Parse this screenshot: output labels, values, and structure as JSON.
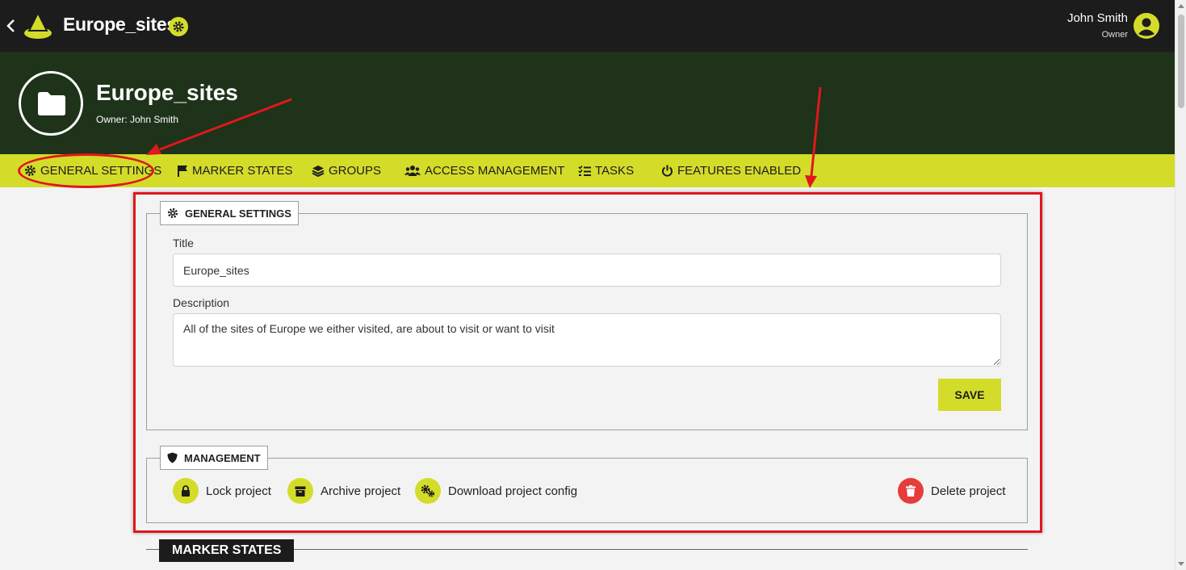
{
  "header": {
    "title": "Europe_sites",
    "user_name": "John Smith",
    "user_role": "Owner"
  },
  "banner": {
    "project_title": "Europe_sites",
    "owner_text": "Owner: John Smith"
  },
  "tabs": [
    {
      "label": "GENERAL SETTINGS",
      "icon": "gear-icon"
    },
    {
      "label": "MARKER STATES",
      "icon": "flag-icon"
    },
    {
      "label": "GROUPS",
      "icon": "layers-icon"
    },
    {
      "label": "ACCESS MANAGEMENT",
      "icon": "users-icon"
    },
    {
      "label": "TASKS",
      "icon": "checklist-icon"
    },
    {
      "label": "FEATURES ENABLED",
      "icon": "power-icon"
    }
  ],
  "general_settings": {
    "legend": "GENERAL SETTINGS",
    "title_label": "Title",
    "title_value": "Europe_sites",
    "description_label": "Description",
    "description_value": "All of the sites of Europe we either visited, are about to visit or want to visit",
    "save_label": "SAVE"
  },
  "management": {
    "legend": "MANAGEMENT",
    "actions": [
      {
        "label": "Lock project",
        "icon": "lock-icon"
      },
      {
        "label": "Archive project",
        "icon": "archive-icon"
      },
      {
        "label": "Download project config",
        "icon": "gears-icon"
      },
      {
        "label": "Delete project",
        "icon": "trash-icon"
      }
    ]
  },
  "marker_states_heading": "MARKER STATES",
  "colors": {
    "accent": "#d4dc2a",
    "topbar": "#1c1c1c",
    "banner": "#1e3319",
    "highlight": "#e0171b",
    "danger": "#e63c3c"
  }
}
